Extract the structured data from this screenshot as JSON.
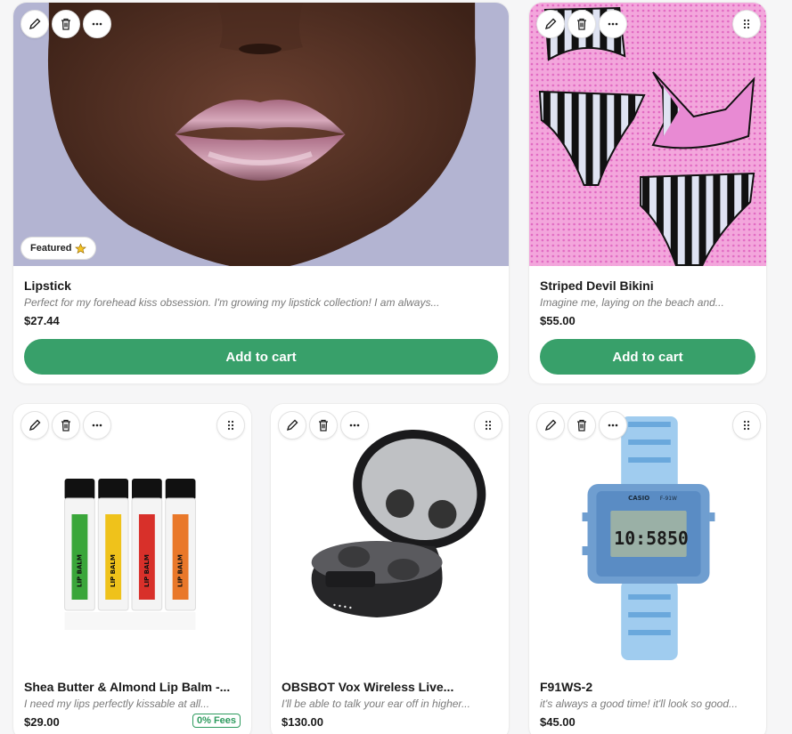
{
  "products": [
    {
      "title": "Lipstick",
      "description": "Perfect for my forehead kiss obsession. I'm growing my lipstick collection! I am always...",
      "price": "$27.44",
      "badge": "Featured",
      "cta": "Add to cart",
      "image": "lips-closeup-photo"
    },
    {
      "title": "Striped Devil Bikini",
      "description": "Imagine me, laying on the beach and...",
      "price": "$55.00",
      "cta": "Add to cart",
      "image": "striped-bikini-photo"
    },
    {
      "title": "Shea Butter & Almond Lip Balm -...",
      "description": "I need my lips perfectly kissable at all...",
      "price": "$29.00",
      "fees_badge": "0% Fees",
      "image": "lip-balm-tubes-photo",
      "tube_label": "LIP BALM"
    },
    {
      "title": "OBSBOT Vox Wireless Live...",
      "description": "I'll be able to talk your ear off in higher...",
      "price": "$130.00",
      "image": "wireless-earbuds-photo"
    },
    {
      "title": "F91WS-2",
      "description": "it's always a good time! it'll look so good...",
      "price": "$45.00",
      "image": "digital-watch-photo",
      "watch_brand": "CASIO",
      "watch_model": "F-91W",
      "watch_time": "10:5850"
    }
  ],
  "icons": [
    "pencil-icon",
    "trash-icon",
    "more-icon",
    "drag-handle-icon",
    "star-icon"
  ],
  "colors": {
    "accent": "#38a06a",
    "fees": "#2e9b5e",
    "bikini_bg": "#f3a6dc"
  }
}
